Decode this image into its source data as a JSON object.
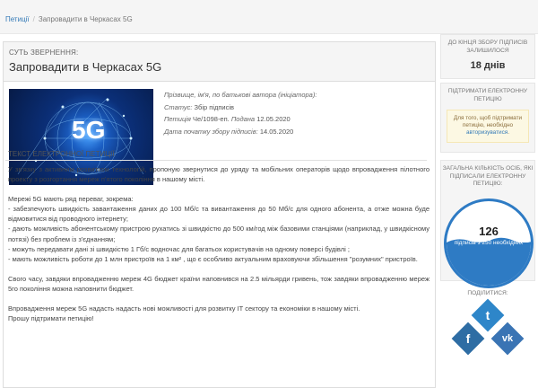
{
  "breadcrumb": {
    "root": "Петиції",
    "current": "Запровадити в Черкасах 5G"
  },
  "petition": {
    "section_label": "СУТЬ ЗВЕРНЕННЯ:",
    "title": "Запровадити в Черкасах 5G",
    "image_text": "5G",
    "meta": {
      "author_label": "Прізвище, ім'я, по батькові автора (ініціатора):",
      "status_label": "Статус:",
      "status_value": "Збір підписів",
      "number_label": "Петиція",
      "number_value": "Че/1098-еп.",
      "submitted_label": "Подана",
      "submitted_value": "12.05.2020",
      "start_label": "Дата початку збору підписів:",
      "start_value": "14.05.2020"
    },
    "text_header": "ТЕКСТ ЕЛЕКТРОННОЇ ПЕТИЦІЇ:",
    "paragraphs": [
      "У зв'язку з активним розвитком технологій, пропоную звернутися до уряду та мобільних операторів щодо впровадження пілотного проекту з розгортання мереж п'ятого покоління в нашому місті.",
      "Мережі 5G мають ряд переваг, зокрема:",
      "- забезпечують швидкість завантаження даних до 100 Мб/с та вивантаження до 50 Мб/с для одного абонента, а отже можна буде відмовитися від проводного інтернету;",
      "- дають можливість абонентському пристрою рухатись зі швидкістю до 500 км/год між базовими станціями (наприклад, у швидкісному потязі) без проблем із з'єднанням;",
      "- можуть передавати дані зі швидкістю 1 Гб/с водночас для багатьох користувачів на одному поверсі будівлі ;",
      "- мають можливість роботи до 1 млн пристроїв на 1 км² , що є особливо актуальним враховуючи збільшення \"розумних\" пристроїв.",
      "Свого часу, завдяки впровадженню мереж 4G бюджет країни наповнився на 2.5 мільярди гривень, тож завдяки впровадженню мереж 5го покоління можна наповнити бюджет.",
      "Впровадження мереж 5G надасть надасть нові можливості для розвитку IT сектору та економіки в нашому місті.",
      "Прошу підтримати петицію!"
    ]
  },
  "sidebar": {
    "deadline_caption": "ДО КІНЦЯ ЗБОРУ ПІДПИСІВ ЗАЛИШИЛОСЯ",
    "days_left": "18 днів",
    "support_caption": "ПІДТРИМАТИ ЕЛЕКТРОННУ ПЕТИЦІЮ",
    "login_prefix": "Для того, щоб підтримати петицію, необхідно",
    "login_link": "авторизуватися",
    "login_suffix": ".",
    "count_caption": "ЗАГАЛЬНА КІЛЬКІСТЬ ОСІБ, ЯКІ ПІДПИСАЛИ ЕЛЕКТРОННУ ПЕТИЦІЮ:",
    "signatures": "126",
    "signatures_needed": "підписів з 250 необхідних",
    "signatures_fraction": 0.504,
    "share_caption": "ПОДІЛИТИСЯ:",
    "social": [
      {
        "name": "twitter",
        "glyph": "t",
        "color": "#2e86c9"
      },
      {
        "name": "facebook",
        "glyph": "f",
        "color": "#2e6da4"
      },
      {
        "name": "vk",
        "glyph": "vk",
        "color": "#3a74b4"
      }
    ]
  },
  "colors": {
    "accent": "#2e7bc4",
    "link": "#337ab7",
    "warning_bg": "#fcf8e3"
  }
}
